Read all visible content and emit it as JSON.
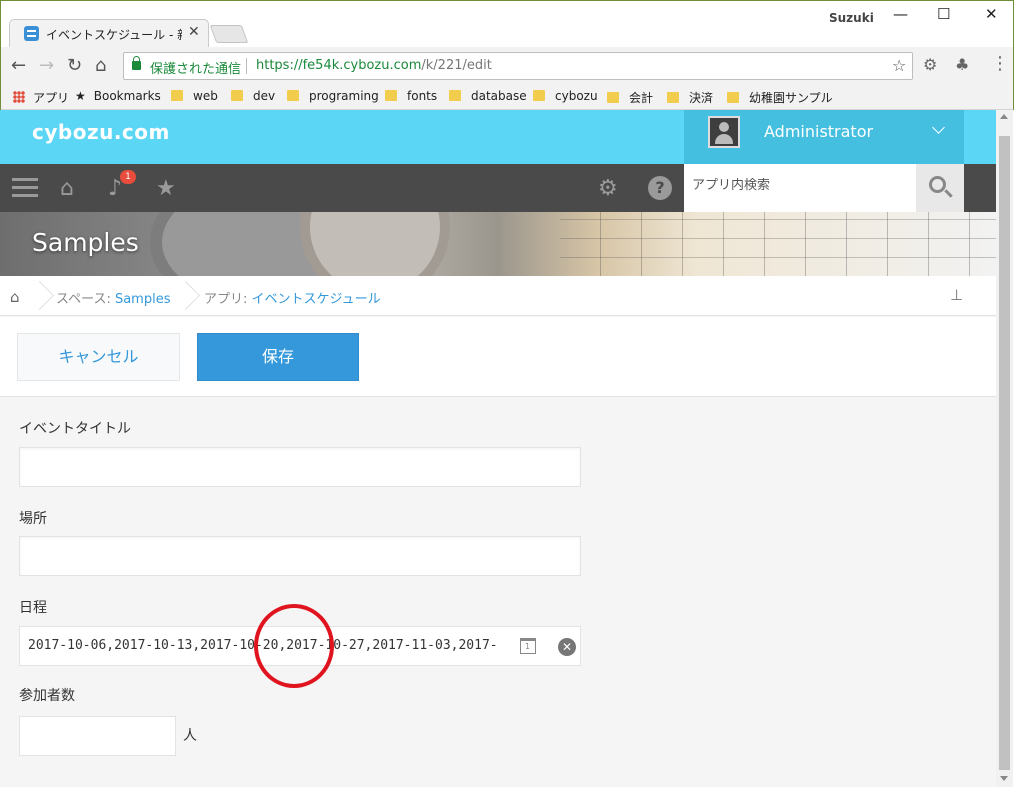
{
  "browser": {
    "tab_title": "イベントスケジュール - 新しい",
    "tab_close": "✕",
    "user_name": "Suzuki",
    "minimize": "—",
    "maximize": "☐",
    "close": "✕",
    "secure_label": "保護された通信",
    "url_host": "https://fe54k.cybozu.com",
    "url_path": "/k/221/edit",
    "bookmarks": [
      "アプリ",
      "Bookmarks",
      "web",
      "dev",
      "programing",
      "fonts",
      "database",
      "cybozu",
      "会計",
      "決済",
      "幼稚園サンプル"
    ]
  },
  "app": {
    "logo": "cybozu.com",
    "user_display_name": "Administrator",
    "notification_count": "1",
    "search_placeholder": "アプリ内検索",
    "space_title": "Samples",
    "breadcrumb": {
      "space_prefix": "スペース: ",
      "space_name": "Samples",
      "app_prefix": "アプリ: ",
      "app_name": "イベントスケジュール"
    },
    "actions": {
      "cancel_label": "キャンセル",
      "save_label": "保存"
    },
    "form": {
      "event_title_label": "イベントタイトル",
      "event_title_value": "",
      "location_label": "場所",
      "location_value": "",
      "schedule_label": "日程",
      "schedule_value": "2017-10-06,2017-10-13,2017-10-20,2017-10-27,2017-11-03,2017-",
      "calendar_day": "1",
      "clear_symbol": "✕",
      "participants_label": "参加者数",
      "participants_value": "",
      "participants_unit": "人"
    }
  },
  "colors": {
    "header_cyan": "#5bd6f5",
    "nav_dark": "#4a4a4a",
    "accent_blue": "#3498db",
    "annotation_red": "#e0141e"
  }
}
